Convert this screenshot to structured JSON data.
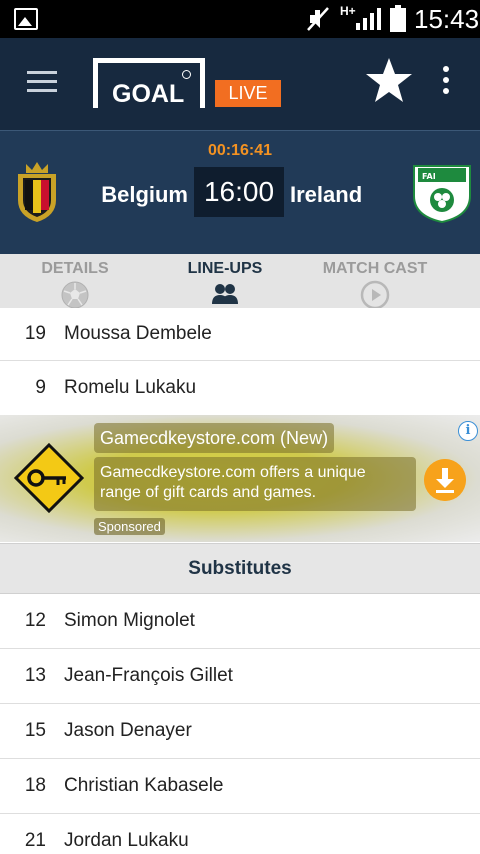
{
  "status_bar": {
    "network": "H+",
    "time": "15:43"
  },
  "app_bar": {
    "logo": "GOAL",
    "live_label": "LIVE"
  },
  "match": {
    "elapsed": "00:16:41",
    "home_team": "Belgium",
    "away_team": "Ireland",
    "score": "16:00"
  },
  "tabs": [
    {
      "label": "DETAILS",
      "active": false
    },
    {
      "label": "LINE-UPS",
      "active": true
    },
    {
      "label": "MATCH CAST",
      "active": false
    }
  ],
  "starting_players": [
    {
      "number": "19",
      "name": "Moussa Dembele"
    },
    {
      "number": "9",
      "name": "Romelu Lukaku"
    }
  ],
  "ad": {
    "title": "Gamecdkeystore.com (New)",
    "body": "Gamecdkeystore.com offers a unique range of gift cards and games.",
    "sponsored": "Sponsored",
    "info": "i"
  },
  "substitutes_header": "Substitutes",
  "substitutes": [
    {
      "number": "12",
      "name": "Simon Mignolet"
    },
    {
      "number": "13",
      "name": "Jean-François Gillet"
    },
    {
      "number": "15",
      "name": "Jason Denayer"
    },
    {
      "number": "18",
      "name": "Christian Kabasele"
    },
    {
      "number": "21",
      "name": "Jordan Lukaku"
    }
  ],
  "colors": {
    "accent": "#f26e21",
    "header": "#17293f",
    "score_bg": "#213a57",
    "timer": "#f39222"
  }
}
